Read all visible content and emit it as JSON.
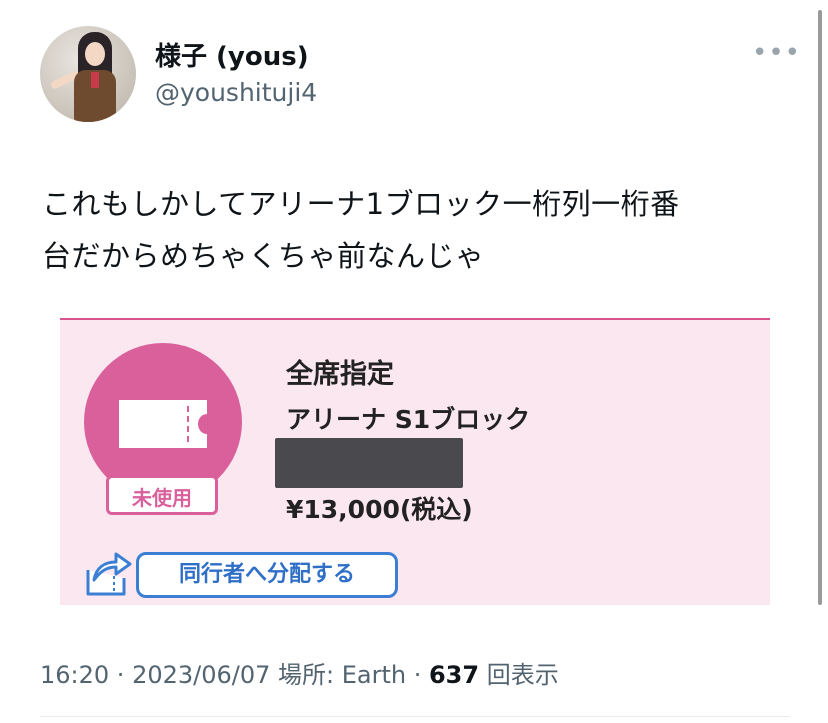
{
  "author": {
    "display_name": "様子 (yous)",
    "handle": "@youshituji4"
  },
  "more_icon": "more-horizontal-icon",
  "tweet": {
    "text_line1": "これもしかしてアリーナ1ブロック一桁列一桁番",
    "text_line2": "台だからめちゃくちゃ前なんじゃ"
  },
  "ticket": {
    "seat_type": "全席指定",
    "block": "アリーナ S1ブロック",
    "price": "¥13,000(税込)",
    "status_badge": "未使用",
    "share_button": "同行者へ分配する",
    "ticket_icon": "ticket-icon",
    "share_icon": "share-arrow-icon"
  },
  "meta": {
    "time": "16:20",
    "sep1": " · ",
    "date": "2023/06/07",
    "location": " 場所: Earth",
    "sep2": " · ",
    "views": "637",
    "views_label": " 回表示"
  },
  "colors": {
    "accent_pink": "#d9609b",
    "card_bg": "#fbe7f0",
    "button_blue": "#3b7fd4",
    "muted_text": "#536471"
  }
}
